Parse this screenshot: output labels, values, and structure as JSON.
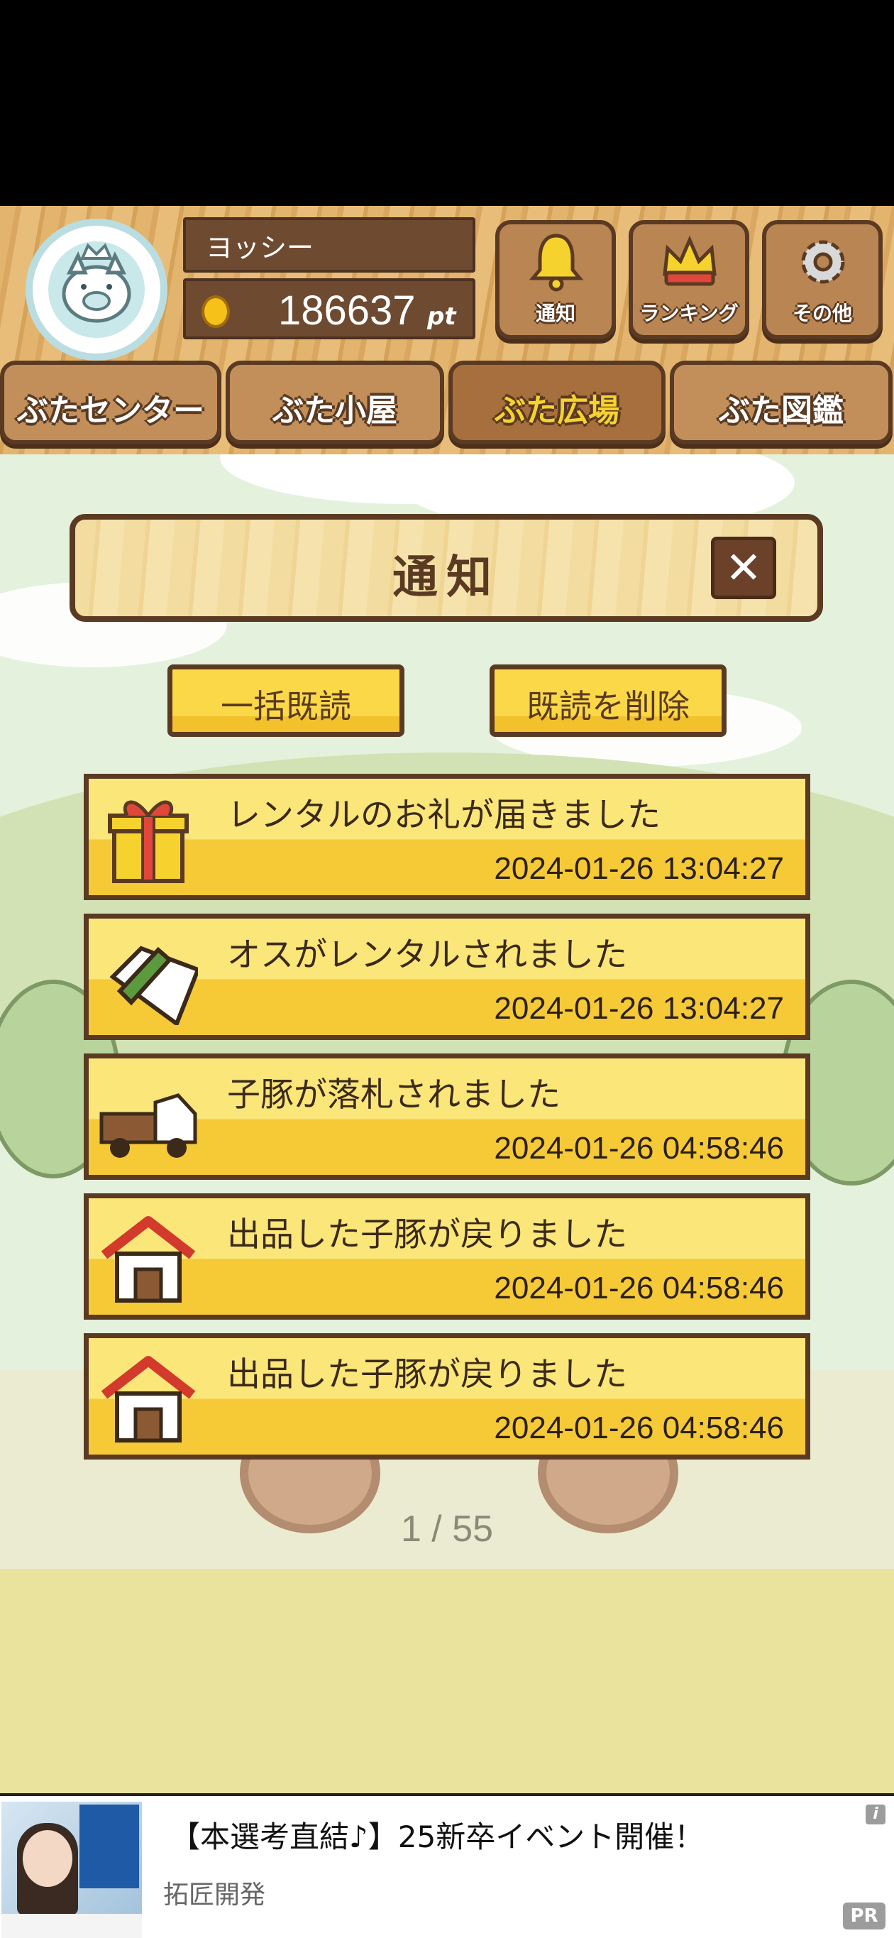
{
  "header": {
    "username": "ヨッシー",
    "points_value": "186637",
    "points_unit": "pt",
    "buttons": [
      {
        "label": "通知",
        "icon": "bell-icon"
      },
      {
        "label": "ランキング",
        "icon": "crown-icon"
      },
      {
        "label": "その他",
        "icon": "gear-icon"
      }
    ]
  },
  "tabs": [
    {
      "label": "ぶたセンター",
      "active": false
    },
    {
      "label": "ぶた小屋",
      "active": false
    },
    {
      "label": "ぶた広場",
      "active": true
    },
    {
      "label": "ぶた図鑑",
      "active": false
    }
  ],
  "panel": {
    "title": "通知",
    "close_label": "✕",
    "mark_all_read": "一括既読",
    "delete_read": "既読を削除"
  },
  "notifications": [
    {
      "text": "レンタルのお礼が届きました",
      "time": "2024-01-26 13:04:27",
      "icon": "gift-icon"
    },
    {
      "text": "オスがレンタルされました",
      "time": "2024-01-26 13:04:27",
      "icon": "letter-pen-icon"
    },
    {
      "text": "子豚が落札されました",
      "time": "2024-01-26 04:58:46",
      "icon": "truck-icon"
    },
    {
      "text": "出品した子豚が戻りました",
      "time": "2024-01-26 04:58:46",
      "icon": "barn-icon"
    },
    {
      "text": "出品した子豚が戻りました",
      "time": "2024-01-26 04:58:46",
      "icon": "barn-icon"
    }
  ],
  "pager": "1 / 55",
  "ad": {
    "title": "【本選考直結♪】25新卒イベント開催！",
    "advertiser": "拓匠開発",
    "pr_label": "PR",
    "info_label": "i"
  },
  "colors": {
    "wood_dark": "#5a3a22",
    "accent_yellow": "#f6d22e",
    "notice_yellow": "#fbe67a",
    "notice_gold": "#f6c937"
  }
}
